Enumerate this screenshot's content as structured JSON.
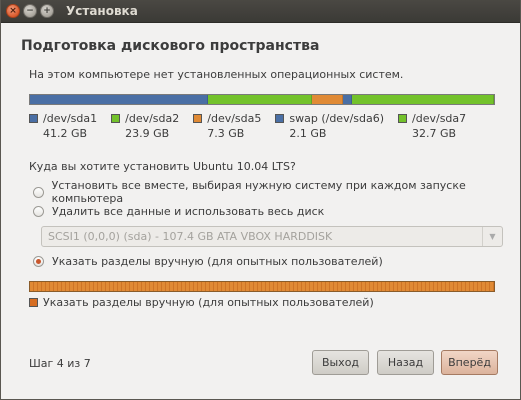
{
  "window": {
    "title": "Установка",
    "controls": {
      "close": "×",
      "minimize": "−",
      "maximize": "+"
    }
  },
  "page": {
    "heading": "Подготовка дискового пространства",
    "subtitle": "На этом компьютере нет установленных операционных систем."
  },
  "disk": {
    "partitions": [
      {
        "name": "/dev/sda1",
        "size": "41.2 GB",
        "size_gb": 41.2,
        "color": "#4a6fa5"
      },
      {
        "name": "/dev/sda2",
        "size": "23.9 GB",
        "size_gb": 23.9,
        "color": "#73c22b"
      },
      {
        "name": "/dev/sda5",
        "size": "7.3 GB",
        "size_gb": 7.3,
        "color": "#e08a35"
      },
      {
        "name": "swap (/dev/sda6)",
        "size": "2.1 GB",
        "size_gb": 2.1,
        "color": "#4a6fa5"
      },
      {
        "name": "/dev/sda7",
        "size": "32.7 GB",
        "size_gb": 32.7,
        "color": "#73c22b"
      }
    ]
  },
  "install": {
    "question": "Куда вы хотите установить Ubuntu 10.04 LTS?",
    "options": [
      {
        "label": "Установить все вместе, выбирая нужную систему при каждом запуске компьютера",
        "selected": false
      },
      {
        "label": "Удалить все данные и использовать весь диск",
        "selected": false
      },
      {
        "label": "Указать разделы вручную (для опытных пользователей)",
        "selected": true
      }
    ],
    "disk_select": {
      "value": "SCSI1 (0,0,0) (sda) - 107.4 GB ATA VBOX HARDDISK",
      "enabled": false
    },
    "preview": {
      "label": "Указать разделы вручную (для опытных пользователей)",
      "color": "#d66d22"
    }
  },
  "footer": {
    "step": "Шаг 4 из 7",
    "quit": "Выход",
    "back": "Назад",
    "forward": "Вперёд"
  }
}
